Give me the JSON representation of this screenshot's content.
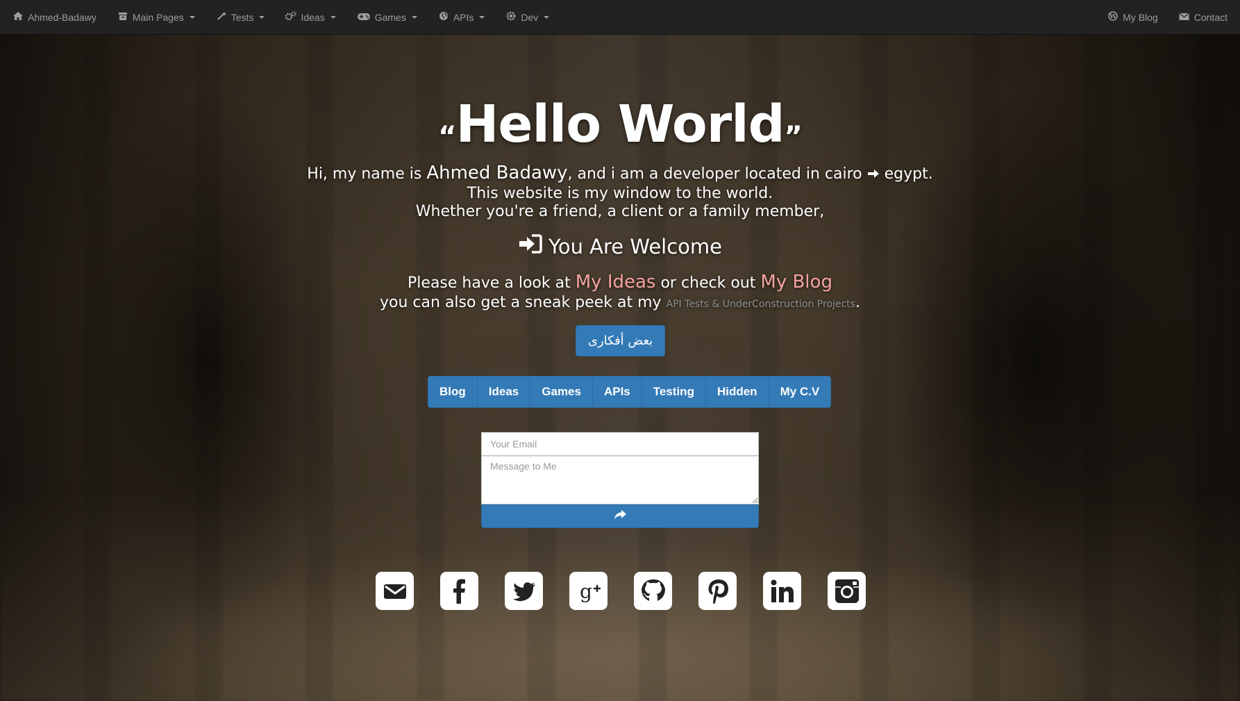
{
  "navbar": {
    "brand": "Ahmed-Badawy",
    "menus": [
      {
        "label": "Main Pages",
        "icon": "archive-icon"
      },
      {
        "label": "Tests",
        "icon": "wand-icon"
      },
      {
        "label": "Ideas",
        "icon": "gears-icon"
      },
      {
        "label": "Games",
        "icon": "gamepad-icon"
      },
      {
        "label": "APIs",
        "icon": "globe-icon"
      },
      {
        "label": "Dev",
        "icon": "gear-icon"
      }
    ],
    "right": [
      {
        "label": "My Blog",
        "icon": "wordpress-icon"
      },
      {
        "label": "Contact",
        "icon": "envelope-icon"
      }
    ]
  },
  "hero": {
    "open_quote": "“",
    "title": "Hello World",
    "close_quote": "”"
  },
  "intro": {
    "pre": "Hi, my name is ",
    "name": "Ahmed Badawy",
    "mid": ", and i am a developer located in cairo ",
    "post": " egypt.",
    "line2": "This website is my window to the world.",
    "line3": "Whether you're a friend, a client or a family member,"
  },
  "welcome": {
    "text": "You Are Welcome"
  },
  "look": {
    "pre": "Please have a look at ",
    "ideas_link": "My Ideas",
    "mid": " or check out ",
    "blog_link": "My Blog",
    "line2_pre": "you can also get a sneak peek at my ",
    "line2_link": "API Tests & UnderConstruction Projects",
    "line2_post": "."
  },
  "arabic_button": "بعض أفكارى",
  "button_group": [
    "Blog",
    "Ideas",
    "Games",
    "APIs",
    "Testing",
    "Hidden",
    "My C.V"
  ],
  "form": {
    "email_placeholder": "Your Email",
    "message_placeholder": "Message to Me"
  },
  "social": [
    "email-icon",
    "facebook-icon",
    "twitter-icon",
    "google-plus-icon",
    "github-icon",
    "pinterest-icon",
    "linkedin-icon",
    "instagram-icon"
  ],
  "colors": {
    "navbar_bg": "#222222",
    "primary": "#337ab7",
    "link_pink": "#f4a3a0"
  }
}
